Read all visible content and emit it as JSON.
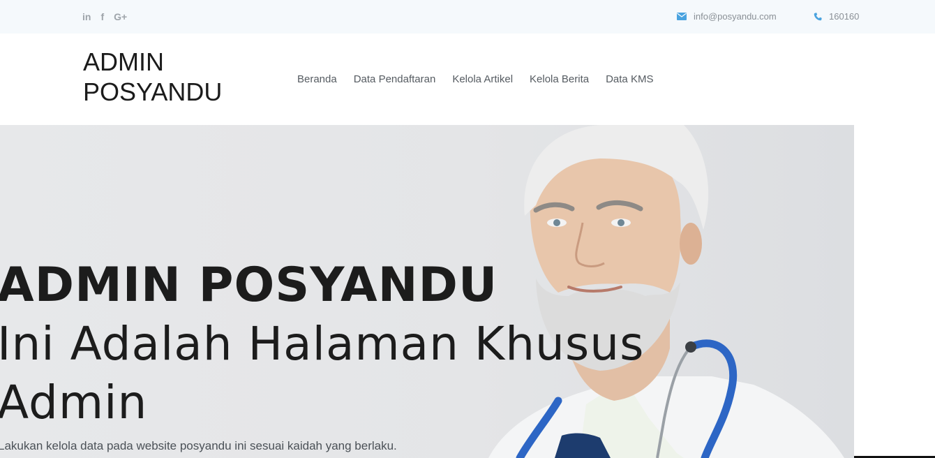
{
  "topbar": {
    "social": [
      {
        "icon": "linkedin-icon",
        "glyph": "in"
      },
      {
        "icon": "facebook-icon",
        "glyph": "f"
      },
      {
        "icon": "google-plus-icon",
        "glyph": "G+"
      }
    ],
    "email": "info@posyandu.com",
    "phone": "160160",
    "icon_color": "#4aa3df"
  },
  "header": {
    "brand_line1": "ADMIN",
    "brand_line2": "POSYANDU",
    "nav": [
      "Beranda",
      "Data Pendaftaran",
      "Kelola Artikel",
      "Kelola Berita",
      "Data KMS"
    ]
  },
  "hero": {
    "title": "ADMIN POSYANDU",
    "subtitle": "Ini Adalah Halaman Khusus Admin",
    "description": "Lakukan kelola data pada website posyandu ini sesuai kaidah yang berlaku."
  }
}
